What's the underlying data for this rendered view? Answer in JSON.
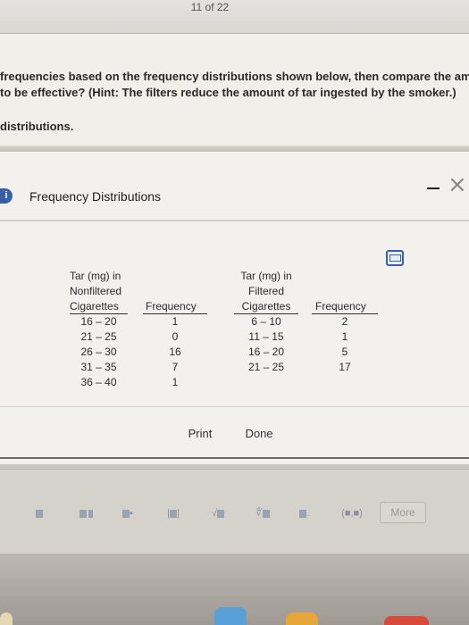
{
  "page_counter": "11 of 22",
  "question": {
    "line1": "frequencies based on the frequency distributions shown below, then compare the am",
    "line2": "to be effective? (Hint: The filters reduce the amount of tar ingested by the smoker.)",
    "line3": "distributions."
  },
  "dialog": {
    "title": "Frequency Distributions",
    "print_label": "Print",
    "done_label": "Done",
    "close_glyph": "×"
  },
  "table": {
    "nonfiltered": {
      "header_line1": "Tar (mg) in",
      "header_line2": "Nonfiltered",
      "header_line3": "Cigarettes",
      "freq_header": "Frequency",
      "rows": [
        {
          "range": "16 – 20",
          "freq": "1"
        },
        {
          "range": "21 – 25",
          "freq": "0"
        },
        {
          "range": "26 – 30",
          "freq": "16"
        },
        {
          "range": "31 – 35",
          "freq": "7"
        },
        {
          "range": "36 – 40",
          "freq": "1"
        }
      ]
    },
    "filtered": {
      "header_line1": "Tar (mg) in",
      "header_line2": "Filtered",
      "header_line3": "Cigarettes",
      "freq_header": "Frequency",
      "rows": [
        {
          "range": "6 – 10",
          "freq": "2"
        },
        {
          "range": "11 – 15",
          "freq": "1"
        },
        {
          "range": "16 – 20",
          "freq": "5"
        },
        {
          "range": "21 – 25",
          "freq": "17"
        }
      ]
    }
  },
  "toolbar": {
    "paren_label": "(■,■)",
    "more_label": "More"
  }
}
